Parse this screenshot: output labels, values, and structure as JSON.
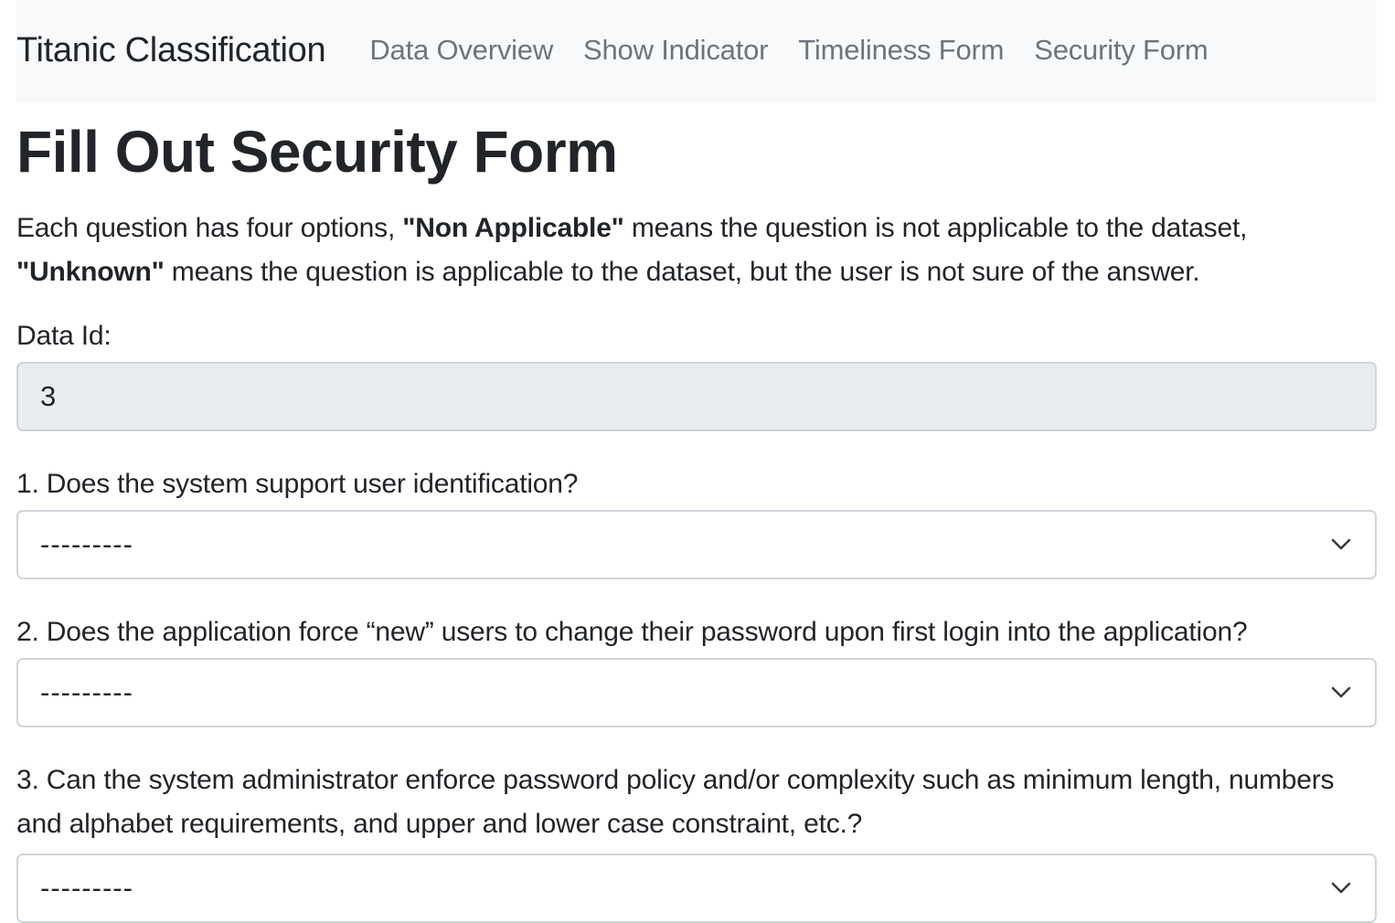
{
  "navbar": {
    "brand": "Titanic Classification",
    "links": [
      {
        "label": "Data Overview"
      },
      {
        "label": "Show Indicator"
      },
      {
        "label": "Timeliness Form"
      },
      {
        "label": "Security Form"
      }
    ]
  },
  "page": {
    "title": "Fill Out Security Form",
    "intro": {
      "part1": "Each question has four options, ",
      "bold1": "\"Non Applicable\"",
      "part2": " means the question is not applicable to the dataset, ",
      "bold2": "\"Unknown\"",
      "part3": " means the question is applicable to the dataset, but the user is not sure of the answer."
    }
  },
  "form": {
    "data_id": {
      "label": "Data Id:",
      "value": "3"
    },
    "questions": [
      {
        "label": "1. Does the system support user identification?",
        "selected": "---------"
      },
      {
        "label": "2. Does the application force “new” users to change their password upon first login into the application?",
        "selected": "---------"
      },
      {
        "label": "3. Can the system administrator enforce password policy and/or complexity such as minimum length, numbers and alphabet requirements, and upper and lower case constraint, etc.?",
        "selected": "---------"
      }
    ]
  },
  "icons": {
    "select_arrow": "chevron-down-icon"
  }
}
